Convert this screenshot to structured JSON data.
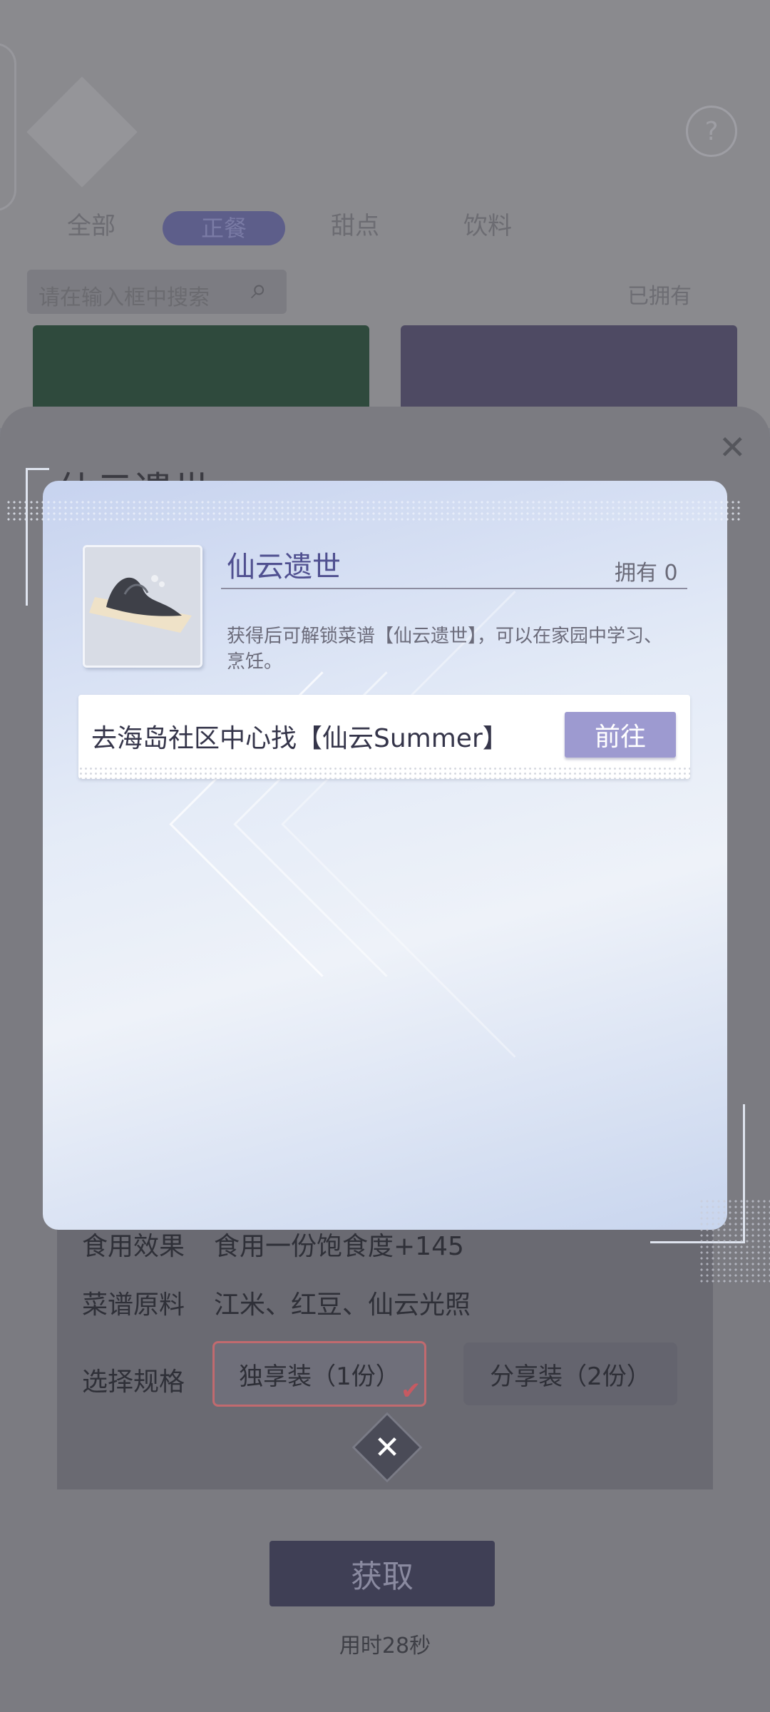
{
  "background": {
    "tabs": [
      "全部",
      "正餐",
      "甜点",
      "饮料"
    ],
    "active_tab": "正餐",
    "search_placeholder": "请在输入框中搜索",
    "owned_filter": "已拥有",
    "help_icon": "question-icon"
  },
  "panel": {
    "title": "仙云遗世",
    "effect_label": "食用效果",
    "effect_value": "食用一份饱食度+145",
    "ingredients_label": "菜谱原料",
    "ingredients_value": "江米、红豆、仙云光照",
    "spec_label": "选择规格",
    "spec_single": "独享装（1份）",
    "spec_share": "分享装（2份）",
    "get_button": "获取",
    "time_text": "用时28秒"
  },
  "popup": {
    "item_name": "仙云遗世",
    "owned": "拥有 0",
    "description": "获得后可解锁菜谱【仙云遗世】，可以在家园中学习、烹饪。",
    "source_text": "去海岛社区中心找【仙云Summer】",
    "goto_button": "前往"
  },
  "colors": {
    "accent": "#9d9ad0",
    "popup_top": "#c7d3ef",
    "selected_border": "#c16a6f"
  }
}
